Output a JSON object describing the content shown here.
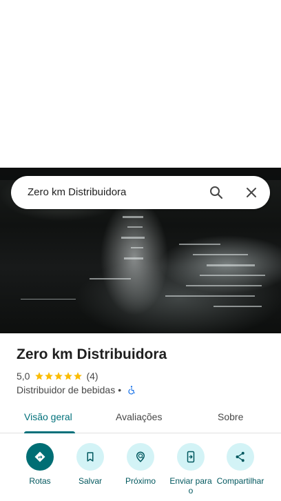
{
  "search": {
    "query": "Zero km Distribuidora"
  },
  "place": {
    "title": "Zero km Distribuidora",
    "rating_value": "5,0",
    "rating_stars": 5,
    "review_count": "(4)",
    "category": "Distribuidor de bebidas",
    "separator": "•"
  },
  "tabs": [
    {
      "label": "Visão geral",
      "active": true
    },
    {
      "label": "Avaliações",
      "active": false
    },
    {
      "label": "Sobre",
      "active": false
    }
  ],
  "actions": [
    {
      "label": "Rotas",
      "icon": "directions-icon"
    },
    {
      "label": "Salvar",
      "icon": "bookmark-icon"
    },
    {
      "label": "Próximo",
      "icon": "nearby-icon"
    },
    {
      "label": "Enviar para o",
      "icon": "send-to-phone-icon"
    },
    {
      "label": "Compartilhar",
      "icon": "share-icon"
    }
  ],
  "colors": {
    "accent": "#00707a",
    "action_bg": "#d3f3f6",
    "primary_action_bg": "#006e74",
    "star": "#fbbc04",
    "wheelchair": "#1a73e8"
  }
}
